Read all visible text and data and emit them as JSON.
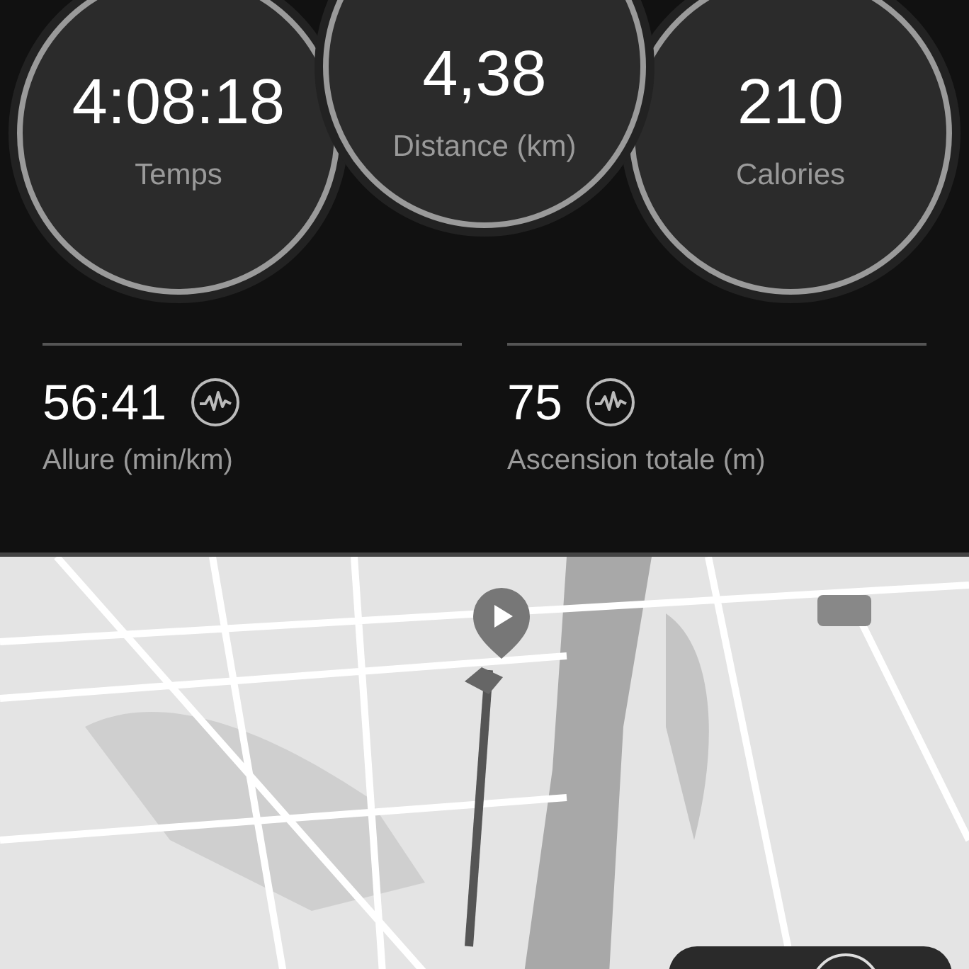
{
  "summary_circles": [
    {
      "value": "4:08:18",
      "label": "Temps"
    },
    {
      "value": "4,38",
      "label": "Distance (km)"
    },
    {
      "value": "210",
      "label": "Calories"
    }
  ],
  "stats": [
    {
      "value": "56:41",
      "label": "Allure (min/km)"
    },
    {
      "value": "75",
      "label": "Ascension totale (m)"
    }
  ]
}
